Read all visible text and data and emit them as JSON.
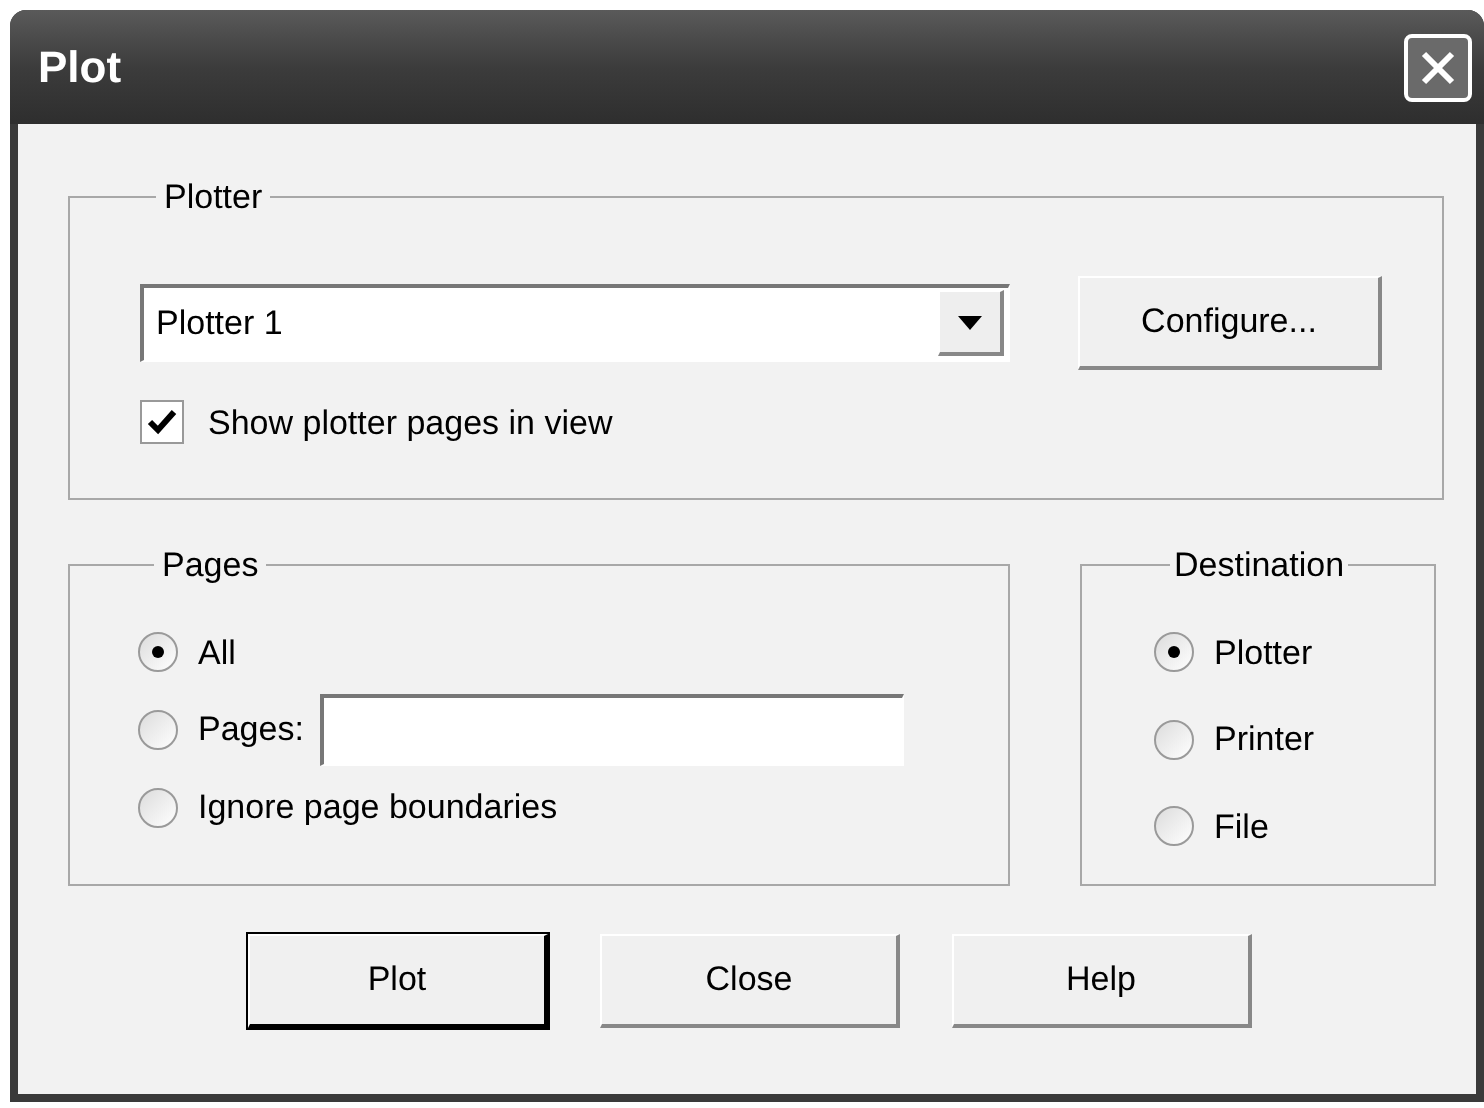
{
  "window": {
    "title": "Plot"
  },
  "plotter": {
    "label": "Plotter",
    "device": "Plotter 1",
    "configure_button": "Configure...",
    "show_pages": {
      "label": "Show plotter pages in view",
      "checked": true
    }
  },
  "pages": {
    "label": "Pages",
    "options": [
      {
        "label": "All",
        "selected": true,
        "kind": "plain"
      },
      {
        "label": "Pages:",
        "selected": false,
        "kind": "range"
      },
      {
        "label": "Ignore page boundaries",
        "selected": false,
        "kind": "plain"
      }
    ]
  },
  "destination": {
    "label": "Destination",
    "options": [
      {
        "label": "Plotter",
        "selected": true
      },
      {
        "label": "Printer",
        "selected": false
      },
      {
        "label": "File",
        "selected": false
      }
    ]
  },
  "buttons": [
    {
      "label": "Plot",
      "default": true
    },
    {
      "label": "Close",
      "default": false
    },
    {
      "label": "Help",
      "default": false
    }
  ]
}
